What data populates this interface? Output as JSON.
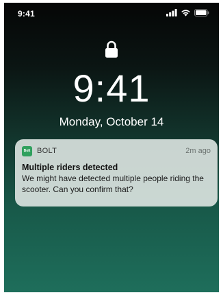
{
  "status_bar": {
    "time": "9:41",
    "icons": [
      "signal-icon",
      "wifi-icon",
      "battery-icon"
    ]
  },
  "lock_screen": {
    "lock_icon": "lock-icon",
    "time": "9:41",
    "date": "Monday, October 14"
  },
  "notification": {
    "app_icon_text": "Bolt",
    "app_name": "BOLT",
    "time_ago": "2m ago",
    "title": "Multiple riders detected",
    "body": "We might have detected multiple people riding the scooter. Can you confirm that?",
    "app_color": "#2fa05d"
  }
}
